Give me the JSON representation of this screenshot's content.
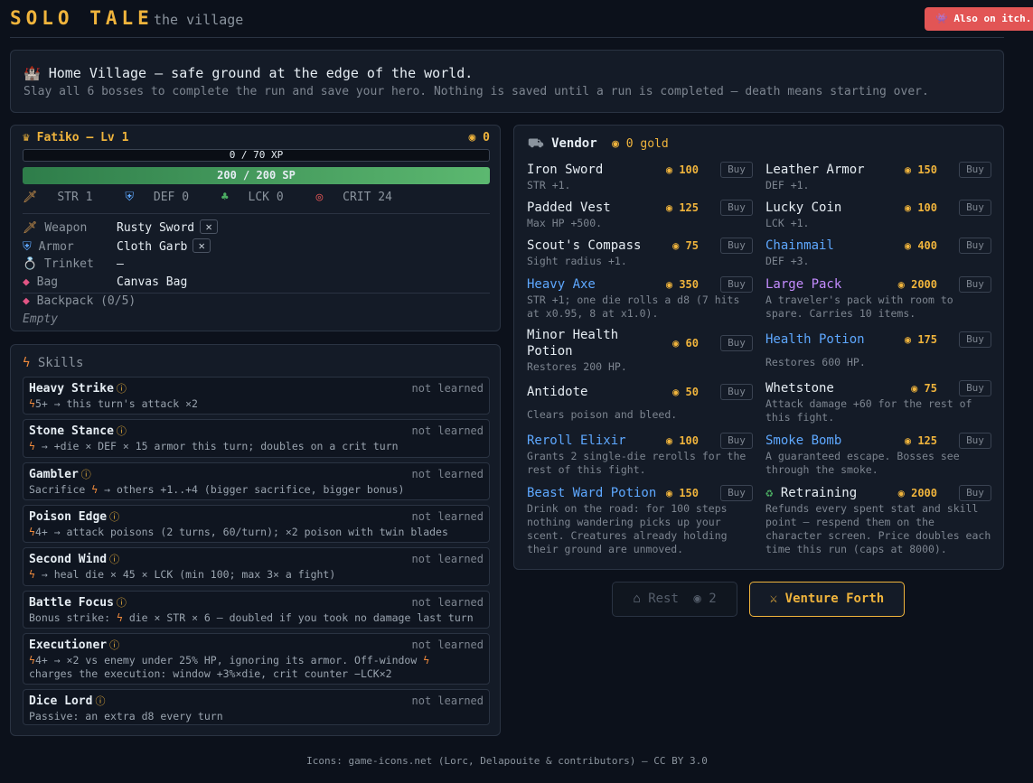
{
  "header": {
    "logo": "SOLO TALE",
    "subtitle": "the village",
    "itch_label": "Also on itch."
  },
  "intro": {
    "title": "Home Village — safe ground at the edge of the world.",
    "description": "Slay all 6 bosses to complete the run and save your hero. Nothing is saved until a run is completed — death means starting over."
  },
  "character": {
    "name": "Fatiko — Lv 1",
    "gold": "0",
    "xp_text": "0 / 70 XP",
    "sp_text": "200 / 200 SP",
    "stats": {
      "str": "STR 1",
      "def": "DEF 0",
      "lck": "LCK 0",
      "crit": "CRIT 24"
    },
    "equipment": {
      "weapon_label": "Weapon",
      "weapon_value": "Rusty Sword",
      "armor_label": "Armor",
      "armor_value": "Cloth Garb",
      "trinket_label": "Trinket",
      "trinket_value": "—",
      "bag_label": "Bag",
      "bag_value": "Canvas Bag",
      "unequip": "✕"
    },
    "backpack_label": "Backpack (0/5)",
    "backpack_empty": "Empty"
  },
  "skills": {
    "title": "Skills",
    "state": "not learned",
    "items": [
      {
        "name": "Heavy Strike",
        "desc": "5+ → this turn's attack ×2"
      },
      {
        "name": "Stone Stance",
        "desc": "→ +die × DEF × 15 armor this turn; doubles on a crit turn"
      },
      {
        "name": "Gambler",
        "desc_a": "Sacrifice",
        "desc_b": "→ others +1..+4 (bigger sacrifice, bigger bonus)"
      },
      {
        "name": "Poison Edge",
        "desc": "4+ → attack poisons (2 turns, 60/turn); ×2 poison with twin blades"
      },
      {
        "name": "Second Wind",
        "desc": "→ heal die × 45 × LCK (min 100; max 3× a fight)"
      },
      {
        "name": "Battle Focus",
        "desc_a": "Bonus strike:",
        "desc_b": "die × STR × 6 — doubled if you took no damage last turn"
      },
      {
        "name": "Executioner",
        "desc_a": "4+ → ×2 vs enemy under 25% HP, ignoring its armor. Off-window",
        "desc_b": "charges the execution: window +3%×die, crit counter −LCK×2"
      },
      {
        "name": "Dice Lord",
        "desc": "Passive: an extra d8 every turn"
      }
    ]
  },
  "vendor": {
    "title": "Vendor",
    "gold": "0 gold",
    "buy_label": "Buy",
    "items": [
      {
        "name": "Iron Sword",
        "price": "100",
        "desc": "STR +1."
      },
      {
        "name": "Leather Armor",
        "price": "150",
        "desc": "DEF +1."
      },
      {
        "name": "Padded Vest",
        "price": "125",
        "desc": "Max HP +500."
      },
      {
        "name": "Lucky Coin",
        "price": "100",
        "desc": "LCK +1."
      },
      {
        "name": "Scout's Compass",
        "price": "75",
        "desc": "Sight radius +1."
      },
      {
        "name": "Chainmail",
        "price": "400",
        "desc": "DEF +3."
      },
      {
        "name": "Heavy Axe",
        "price": "350",
        "desc": "STR +1; one die rolls a d8 (7 hits at x0.95, 8 at x1.0)."
      },
      {
        "name": "Large Pack",
        "price": "2000",
        "desc": "A traveler's pack with room to spare. Carries 10 items."
      },
      {
        "name": "Minor Health Potion",
        "price": "60",
        "desc": "Restores 200 HP."
      },
      {
        "name": "Health Potion",
        "price": "175",
        "desc": "Restores 600 HP."
      },
      {
        "name": "Antidote",
        "price": "50",
        "desc": "Clears poison and bleed."
      },
      {
        "name": "Whetstone",
        "price": "75",
        "desc": "Attack damage +60 for the rest of this fight."
      },
      {
        "name": "Reroll Elixir",
        "price": "100",
        "desc": "Grants 2 single-die rerolls for the rest of this fight."
      },
      {
        "name": "Smoke Bomb",
        "price": "125",
        "desc": "A guaranteed escape. Bosses see through the smoke."
      },
      {
        "name": "Beast Ward Potion",
        "price": "150",
        "desc": "Drink on the road: for 100 steps nothing wandering picks up your scent. Creatures already holding their ground are unmoved."
      },
      {
        "name": "Retraining",
        "price": "2000",
        "desc": "Refunds every spent stat and skill point — respend them on the character screen. Price doubles each time this run (caps at 8000)."
      }
    ]
  },
  "actions": {
    "rest_label": "Rest",
    "rest_cost": "2",
    "forth_label": "Venture Forth"
  },
  "footer": "Icons: game-icons.net (Lorc, Delapouite & contributors) — CC BY 3.0",
  "colors": {
    "accent": "#f0b43c",
    "itch": "#e25555",
    "sp_bar": "#4caf63",
    "blue_item": "#5ea8ff",
    "purple_item": "#c48cff"
  }
}
